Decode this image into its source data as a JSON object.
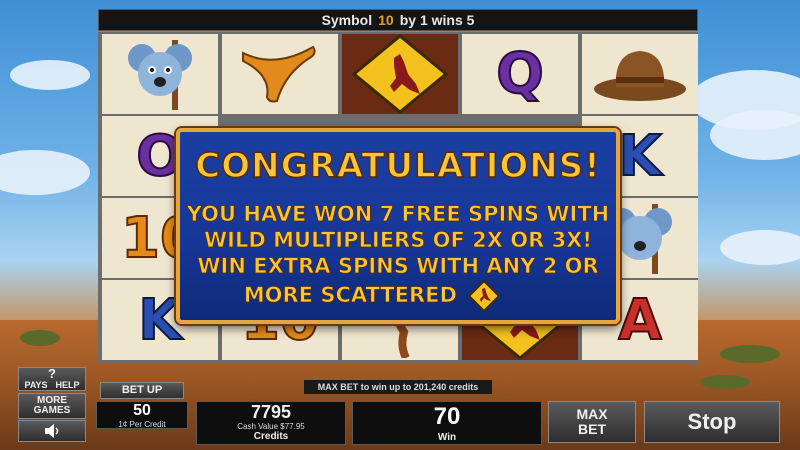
{
  "win_line": {
    "prefix": "Symbol",
    "symbol_number": "10",
    "suffix": "by 1 wins 5"
  },
  "reels": {
    "row1": [
      "koala",
      "boomerang",
      "kangaroo-sign",
      "Q",
      "hat"
    ],
    "row2": [
      "O",
      "",
      "",
      "",
      "K"
    ],
    "row3": [
      "10",
      "",
      "",
      "",
      "koala"
    ],
    "row4": [
      "K",
      "10",
      "emu",
      "kangaroo-sign",
      "A"
    ]
  },
  "popup": {
    "title": "CONGRATULATIONS!",
    "line1": "YOU HAVE WON 7 FREE SPINS WITH",
    "line2": "WILD MULTIPLIERS OF 2X OR 3X!",
    "line3": "WIN EXTRA SPINS WITH ANY 2 OR",
    "line4": "MORE SCATTERED"
  },
  "controls": {
    "pays_label": "PAYS",
    "help_label": "HELP",
    "help_glyph": "?",
    "more_games_line1": "MORE",
    "more_games_line2": "GAMES",
    "sound_icon": "speaker-icon",
    "bet_up_label": "BET UP",
    "bet_value": "50",
    "bet_sub": "1¢ Per Credit",
    "max_bet_notice": "MAX BET to win up to 201,240 credits",
    "credits_value": "7795",
    "cash_value": "Cash Value $77.95",
    "credits_label": "Credits",
    "win_value": "70",
    "win_label": "Win",
    "max_bet_line1": "MAX",
    "max_bet_line2": "BET",
    "stop_label": "Stop"
  },
  "colors": {
    "popup_border": "#e7a63a",
    "popup_text": "#f7c535",
    "popup_bg": "#1a3fa0"
  }
}
